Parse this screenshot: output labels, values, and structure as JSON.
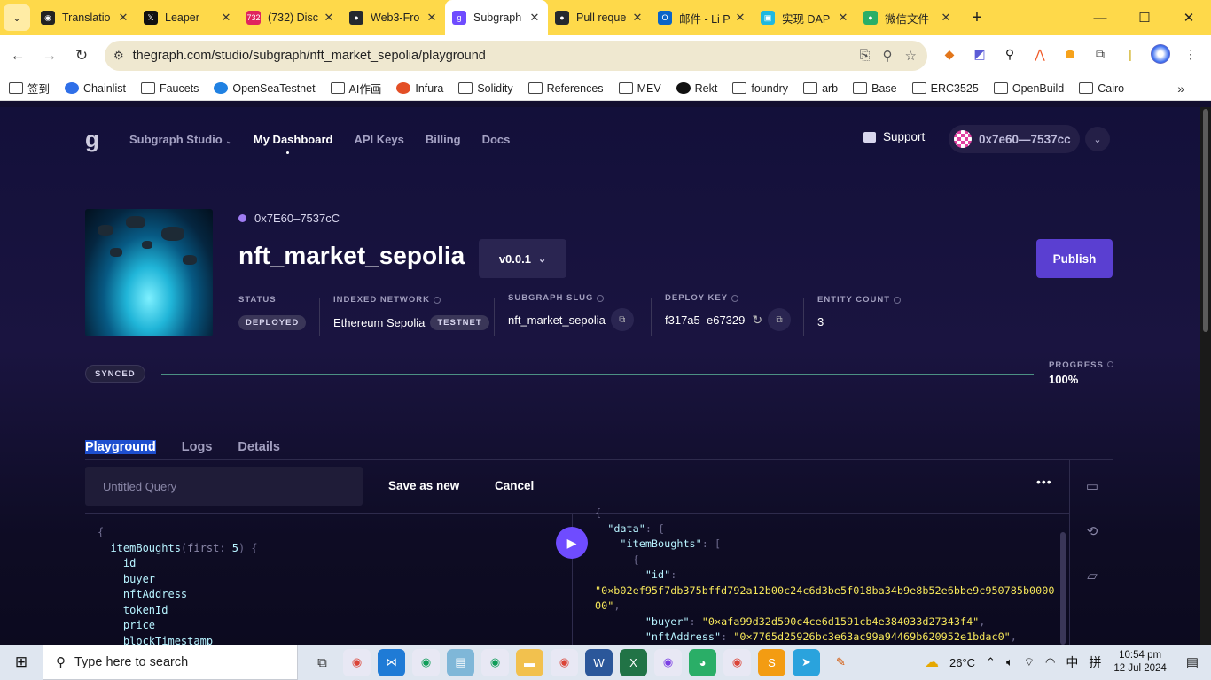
{
  "browser": {
    "tabs": [
      {
        "label": "Translatio",
        "fav_color": "#222222",
        "fav_glyph": "◉"
      },
      {
        "label": "Leaper",
        "fav_color": "#111111",
        "fav_glyph": "𝕏"
      },
      {
        "label": "(732) Disc",
        "fav_color": "#e0245e",
        "fav_glyph": "732"
      },
      {
        "label": "Web3-Fro",
        "fav_color": "#24292e",
        "fav_glyph": "●"
      },
      {
        "label": "Subgraph",
        "fav_color": "#6f4cff",
        "fav_glyph": "g",
        "active": true
      },
      {
        "label": "Pull reque",
        "fav_color": "#24292e",
        "fav_glyph": "●"
      },
      {
        "label": "邮件 - Li P",
        "fav_color": "#0a64c8",
        "fav_glyph": "O"
      },
      {
        "label": "实现 DAP",
        "fav_color": "#1fb8e0",
        "fav_glyph": "▣"
      },
      {
        "label": "微信文件",
        "fav_color": "#2aae67",
        "fav_glyph": "●"
      }
    ],
    "url": "thegraph.com/studio/subgraph/nft_market_sepolia/playground",
    "bookmarks": [
      {
        "label": "签到",
        "kind": "folder"
      },
      {
        "label": "Chainlist",
        "kind": "site",
        "color": "#2f6fe8"
      },
      {
        "label": "Faucets",
        "kind": "folder"
      },
      {
        "label": "OpenSeaTestnet",
        "kind": "site",
        "color": "#2081e2"
      },
      {
        "label": "AI作画",
        "kind": "folder"
      },
      {
        "label": "Infura",
        "kind": "site",
        "color": "#e34f26"
      },
      {
        "label": "Solidity",
        "kind": "folder"
      },
      {
        "label": "References",
        "kind": "folder"
      },
      {
        "label": "MEV",
        "kind": "folder"
      },
      {
        "label": "Rekt",
        "kind": "site",
        "color": "#111111"
      },
      {
        "label": "foundry",
        "kind": "folder"
      },
      {
        "label": "arb",
        "kind": "folder"
      },
      {
        "label": "Base",
        "kind": "folder"
      },
      {
        "label": "ERC3525",
        "kind": "folder"
      },
      {
        "label": "OpenBuild",
        "kind": "folder"
      },
      {
        "label": "Cairo",
        "kind": "folder"
      }
    ]
  },
  "nav": {
    "studio": "Subgraph Studio",
    "dashboard": "My Dashboard",
    "api_keys": "API Keys",
    "billing": "Billing",
    "docs": "Docs",
    "support": "Support",
    "account": "0x7e60—7537cc"
  },
  "subgraph": {
    "owner": "0x7E60–7537cC",
    "name": "nft_market_sepolia",
    "version": "v0.0.1",
    "publish": "Publish",
    "status_label": "STATUS",
    "status": "DEPLOYED",
    "network_label": "INDEXED NETWORK",
    "network": "Ethereum Sepolia",
    "network_tag": "TESTNET",
    "slug_label": "SUBGRAPH SLUG",
    "slug": "nft_market_sepolia",
    "deploy_key_label": "DEPLOY KEY",
    "deploy_key": "f317a5–e67329",
    "entity_label": "ENTITY COUNT",
    "entity_count": "3"
  },
  "sync": {
    "badge": "SYNCED",
    "progress_label": "PROGRESS",
    "progress_text": "100%",
    "progress": 1.0
  },
  "tabs": {
    "playground": "Playground",
    "logs": "Logs",
    "details": "Details"
  },
  "playground": {
    "query_placeholder": "Untitled Query",
    "save_as_new": "Save as new",
    "cancel": "Cancel",
    "query_lines": [
      "itemBoughts",
      "first",
      "5",
      "id",
      "buyer",
      "nftAddress",
      "tokenId",
      "price",
      "blockTimestamp"
    ],
    "result": {
      "data_key": "\"data\"",
      "entity_key": "\"itemBoughts\"",
      "id_key": "\"id\"",
      "id_value": "\"0×b02ef95f7db375bffd792a12b00c24c6d3be5f018ba34b9e8b52e6bbe9c950785b0000",
      "id_value_cont": "00\"",
      "buyer_key": "\"buyer\"",
      "buyer_value": "\"0×afa99d32d590c4ce6d1591cb4e384033d27343f4\"",
      "nft_key": "\"nftAddress\"",
      "nft_value": "\"0×7765d25926bc3e63ac99a94469b620952e1bdac0\""
    }
  },
  "taskbar": {
    "search_placeholder": "Type here to search",
    "temperature": "26°C",
    "ime1": "中",
    "ime2": "拼",
    "time": "10:54 pm",
    "date": "12 Jul 2024"
  }
}
